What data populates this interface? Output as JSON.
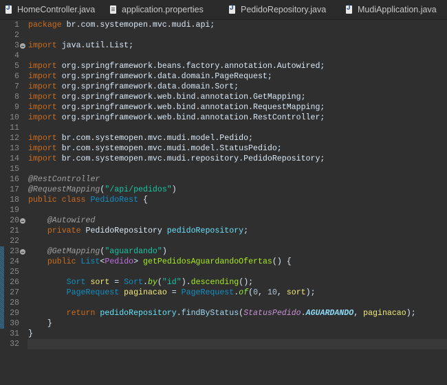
{
  "tabs": [
    {
      "label": "HomeController.java",
      "icon": "java-file-icon"
    },
    {
      "label": "application.properties",
      "icon": "properties-file-icon"
    },
    {
      "label": "PedidoRepository.java",
      "icon": "java-file-icon"
    },
    {
      "label": "MudiApplication.java",
      "icon": "java-file-icon"
    }
  ],
  "editor": {
    "current_line": 32,
    "folded_lines": [
      3,
      20,
      23
    ],
    "changed_lines": [
      23,
      24,
      25,
      26,
      27,
      28,
      29,
      30
    ],
    "lines": [
      [
        [
          "package",
          "kw"
        ],
        [
          " br.com.systemopen.mvc.mudi.api;",
          "tx"
        ]
      ],
      [],
      [
        [
          "import",
          "kw"
        ],
        [
          " java.util.List;",
          "tx"
        ]
      ],
      [],
      [
        [
          "import",
          "kw"
        ],
        [
          " org.springframework.beans.factory.annotation.Autowired;",
          "tx"
        ]
      ],
      [
        [
          "import",
          "kw"
        ],
        [
          " org.springframework.data.domain.PageRequest;",
          "tx"
        ]
      ],
      [
        [
          "import",
          "kw"
        ],
        [
          " org.springframework.data.domain.Sort;",
          "tx"
        ]
      ],
      [
        [
          "import",
          "kw"
        ],
        [
          " org.springframework.web.bind.annotation.GetMapping;",
          "tx"
        ]
      ],
      [
        [
          "import",
          "kw"
        ],
        [
          " org.springframework.web.bind.annotation.RequestMapping;",
          "tx"
        ]
      ],
      [
        [
          "import",
          "kw"
        ],
        [
          " org.springframework.web.bind.annotation.RestController;",
          "tx"
        ]
      ],
      [],
      [
        [
          "import",
          "kw"
        ],
        [
          " br.com.systemopen.mvc.mudi.model.Pedido;",
          "tx"
        ]
      ],
      [
        [
          "import",
          "kw"
        ],
        [
          " br.com.systemopen.mvc.mudi.model.StatusPedido;",
          "tx"
        ]
      ],
      [
        [
          "import",
          "kw"
        ],
        [
          " br.com.systemopen.mvc.mudi.repository.PedidoRepository;",
          "tx"
        ]
      ],
      [],
      [
        [
          "@RestController",
          "an"
        ]
      ],
      [
        [
          "@RequestMapping",
          "an"
        ],
        [
          "(",
          "tx"
        ],
        [
          "\"/api/pedidos\"",
          "st"
        ],
        [
          ")",
          "tx"
        ]
      ],
      [
        [
          "public class ",
          "kw"
        ],
        [
          "PedidoRest",
          "ty"
        ],
        [
          " {",
          "tx"
        ]
      ],
      [],
      [
        [
          "    ",
          "tx"
        ],
        [
          "@Autowired",
          "an"
        ]
      ],
      [
        [
          "    ",
          "tx"
        ],
        [
          "private ",
          "kw"
        ],
        [
          "PedidoRepository ",
          "tx"
        ],
        [
          "pedidoRepository",
          "fd"
        ],
        [
          ";",
          "tx"
        ]
      ],
      [],
      [
        [
          "    ",
          "tx"
        ],
        [
          "@GetMapping",
          "an"
        ],
        [
          "(",
          "tx"
        ],
        [
          "\"aguardando\"",
          "st"
        ],
        [
          ")",
          "tx"
        ]
      ],
      [
        [
          "    ",
          "tx"
        ],
        [
          "public ",
          "kw"
        ],
        [
          "List",
          "ty"
        ],
        [
          "<",
          "tx"
        ],
        [
          "Pedido",
          "tp"
        ],
        [
          "> ",
          "tx"
        ],
        [
          "getPedidosAguardandoOfertas",
          "md"
        ],
        [
          "() {",
          "tx"
        ]
      ],
      [],
      [
        [
          "        ",
          "tx"
        ],
        [
          "Sort ",
          "ty"
        ],
        [
          "sort",
          "lv"
        ],
        [
          " = ",
          "tx"
        ],
        [
          "Sort",
          "ty"
        ],
        [
          ".",
          "tx"
        ],
        [
          "by",
          "sm"
        ],
        [
          "(",
          "tx"
        ],
        [
          "\"id\"",
          "st"
        ],
        [
          ").",
          "tx"
        ],
        [
          "descending",
          "md"
        ],
        [
          "();",
          "tx"
        ]
      ],
      [
        [
          "        ",
          "tx"
        ],
        [
          "PageRequest ",
          "ty"
        ],
        [
          "paginacao",
          "lv"
        ],
        [
          " = ",
          "tx"
        ],
        [
          "PageRequest",
          "ty"
        ],
        [
          ".",
          "tx"
        ],
        [
          "of",
          "sm"
        ],
        [
          "(",
          "tx"
        ],
        [
          "0",
          "nm"
        ],
        [
          ", ",
          "tx"
        ],
        [
          "10",
          "nm"
        ],
        [
          ", ",
          "tx"
        ],
        [
          "sort",
          "lv"
        ],
        [
          ");",
          "tx"
        ]
      ],
      [],
      [
        [
          "        ",
          "tx"
        ],
        [
          "return ",
          "kw"
        ],
        [
          "pedidoRepository",
          "fd"
        ],
        [
          ".",
          "tx"
        ],
        [
          "findByStatus",
          "mc"
        ],
        [
          "(",
          "tx"
        ],
        [
          "StatusPedido",
          "et"
        ],
        [
          ".",
          "tx"
        ],
        [
          "AGUARDANDO",
          "en"
        ],
        [
          ", ",
          "tx"
        ],
        [
          "paginacao",
          "lv"
        ],
        [
          ");",
          "tx"
        ]
      ],
      [
        [
          "    }",
          "tx"
        ]
      ],
      [
        [
          "}",
          "tx"
        ]
      ],
      []
    ]
  }
}
